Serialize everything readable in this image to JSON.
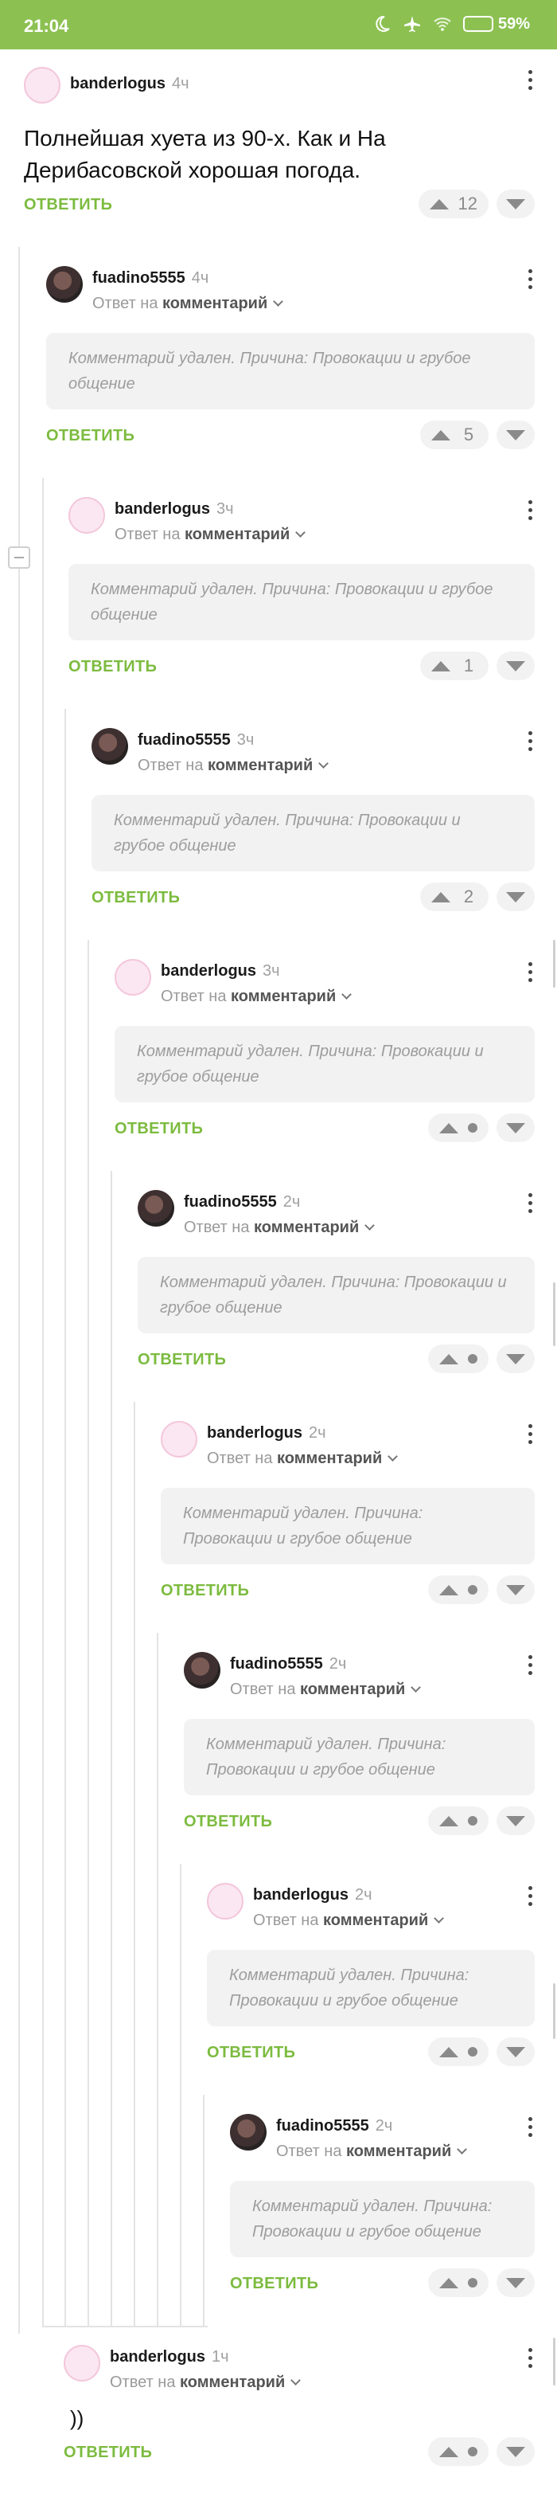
{
  "status_bar": {
    "time": "21:04",
    "battery_percent": "59%",
    "battery_level": 0.59,
    "icons": [
      "moon-icon",
      "airplane-icon",
      "wifi-icon",
      "battery-icon"
    ]
  },
  "comments": [
    {
      "author": "banderlogus",
      "time": "4ч",
      "avatar": "bander",
      "text": "Полнейшая хуета из 90-х. Как и На Дерибасовской хорошая погода.",
      "reply_label": "ОТВЕТИТЬ",
      "score": "12"
    },
    {
      "author": "fuadino5555",
      "time": "4ч",
      "avatar": "fuad",
      "reply_to_prefix": "Ответ на",
      "reply_to_target": "комментарий",
      "deleted_text": "Комментарий удален. Причина: Провокации и грубое общение",
      "reply_label": "ОТВЕТИТЬ",
      "score": "5"
    },
    {
      "author": "banderlogus",
      "time": "3ч",
      "avatar": "bander",
      "reply_to_prefix": "Ответ на",
      "reply_to_target": "комментарий",
      "deleted_text": "Комментарий удален. Причина: Провокации и грубое общение",
      "reply_label": "ОТВЕТИТЬ",
      "score": "1"
    },
    {
      "author": "fuadino5555",
      "time": "3ч",
      "avatar": "fuad",
      "reply_to_prefix": "Ответ на",
      "reply_to_target": "комментарий",
      "deleted_text": "Комментарий удален. Причина: Провокации и грубое общение",
      "reply_label": "ОТВЕТИТЬ",
      "score": "2"
    },
    {
      "author": "banderlogus",
      "time": "3ч",
      "avatar": "bander",
      "reply_to_prefix": "Ответ на",
      "reply_to_target": "комментарий",
      "deleted_text": "Комментарий удален. Причина: Провокации и грубое общение",
      "reply_label": "ОТВЕТИТЬ",
      "score": ""
    },
    {
      "author": "fuadino5555",
      "time": "2ч",
      "avatar": "fuad",
      "reply_to_prefix": "Ответ на",
      "reply_to_target": "комментарий",
      "deleted_text": "Комментарий удален. Причина: Провокации и грубое общение",
      "reply_label": "ОТВЕТИТЬ",
      "score": ""
    },
    {
      "author": "banderlogus",
      "time": "2ч",
      "avatar": "bander",
      "reply_to_prefix": "Ответ на",
      "reply_to_target": "комментарий",
      "deleted_text": "Комментарий удален. Причина: Провокации и грубое общение",
      "reply_label": "ОТВЕТИТЬ",
      "score": ""
    },
    {
      "author": "fuadino5555",
      "time": "2ч",
      "avatar": "fuad",
      "reply_to_prefix": "Ответ на",
      "reply_to_target": "комментарий",
      "deleted_text": "Комментарий удален. Причина: Провокации и грубое общение",
      "reply_label": "ОТВЕТИТЬ",
      "score": ""
    },
    {
      "author": "banderlogus",
      "time": "2ч",
      "avatar": "bander",
      "reply_to_prefix": "Ответ на",
      "reply_to_target": "комментарий",
      "deleted_text": "Комментарий удален. Причина: Провокации и грубое общение",
      "reply_label": "ОТВЕТИТЬ",
      "score": ""
    },
    {
      "author": "fuadino5555",
      "time": "2ч",
      "avatar": "fuad",
      "reply_to_prefix": "Ответ на",
      "reply_to_target": "комментарий",
      "deleted_text": "Комментарий удален. Причина: Провокации и грубое общение",
      "reply_label": "ОТВЕТИТЬ",
      "score": ""
    },
    {
      "author": "banderlogus",
      "time": "1ч",
      "avatar": "bander",
      "reply_to_prefix": "Ответ на",
      "reply_to_target": "комментарий",
      "text": "))",
      "reply_label": "ОТВЕТИТЬ",
      "score": ""
    }
  ],
  "colors": {
    "accent": "#7cbb3f",
    "status_bar": "#8cc152"
  }
}
